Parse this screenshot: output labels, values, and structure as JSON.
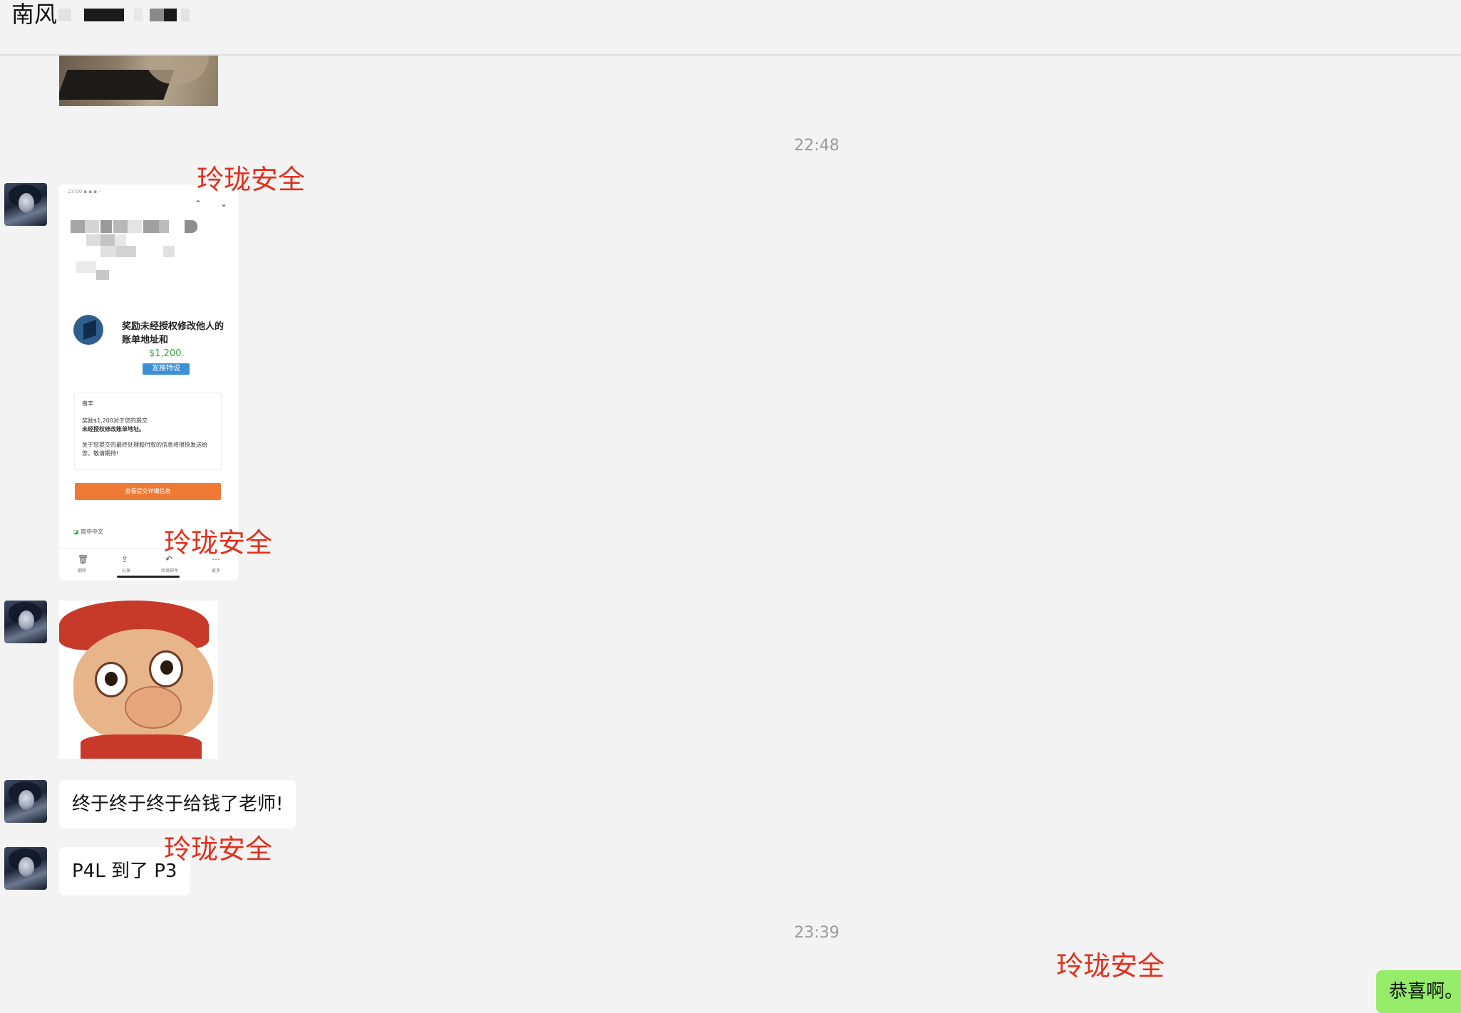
{
  "header": {
    "title": "南风"
  },
  "messages": {
    "time1": "22:48",
    "text1": "终于终于终于给钱了老师!",
    "text2": "P4L 到了 P3",
    "time2": "23:39",
    "mine1": "恭喜啊。"
  },
  "watermark": "玲珑安全",
  "phone": {
    "headline": "奖励未经授权修改他人的账单地址和",
    "amount": "$1,200.",
    "tweet": "发推特说",
    "card_greeting": "南丰",
    "card_line1": "奖励$1,200对于您的提交",
    "card_line2": "未经授权修改账单地址。",
    "card_line3": "关于您提交的最终处理和付款的信息将很快发送给您，敬请期待!",
    "button": "查看提交详细信息",
    "translate": "简中中文",
    "tabs": [
      "删除",
      "分享",
      "转发邮件",
      "更多"
    ]
  },
  "colors": {
    "watermark": "#e0311e",
    "my_bubble": "#95ec69",
    "background": "#f3f3f3"
  }
}
